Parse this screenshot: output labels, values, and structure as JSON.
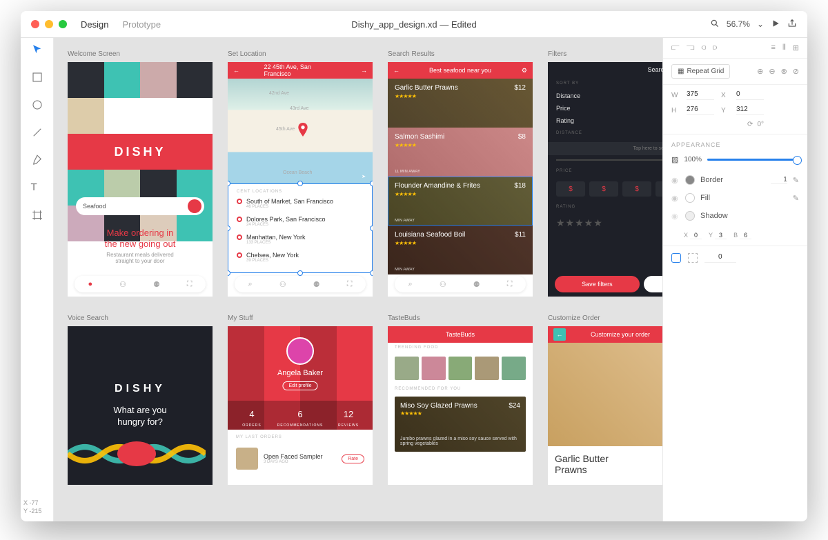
{
  "window": {
    "title": "Dishy_app_design.xd — Edited",
    "tabDesign": "Design",
    "tabPrototype": "Prototype",
    "zoom": "56.7%"
  },
  "coords": {
    "x": "X   -77",
    "y": "Y   -215"
  },
  "artboards": {
    "welcome": {
      "title": "Welcome Screen",
      "logo": "DISHY",
      "searchPlaceholder": "Seafood",
      "heroLine1": "Make ordering in",
      "heroLine2": "the new going out",
      "heroSub": "Restaurant meals delivered\nstraight to your door"
    },
    "location": {
      "title": "Set Location",
      "address": "22 45th Ave, San Francisco",
      "mapLabels": [
        "42nd Ave",
        "43rd Ave",
        "45th Ave",
        "Ocean Beach"
      ],
      "listHeader": "CENT LOCATIONS",
      "items": [
        {
          "name": "South of Market, San Francisco",
          "sub": "46 PLACES"
        },
        {
          "name": "Dolores Park, San Francisco",
          "sub": "24 PLACES"
        },
        {
          "name": "Manhattan, New York",
          "sub": "133 PLACES"
        },
        {
          "name": "Chelsea, New York",
          "sub": "39 PLACES"
        }
      ]
    },
    "results": {
      "title": "Search Results",
      "header": "Best seafood near you",
      "dishes": [
        {
          "name": "Garlic Butter Prawns",
          "price": "$12"
        },
        {
          "name": "Salmon Sashimi",
          "price": "$8",
          "dist": "11 MIN AWAY"
        },
        {
          "name": "Flounder Amandine & Frites",
          "price": "$18",
          "dist": "MIN AWAY"
        },
        {
          "name": "Louisiana Seafood Boil",
          "price": "$11",
          "dist": "MIN AWAY"
        }
      ]
    },
    "filters": {
      "title": "Filters",
      "header": "Search Filters",
      "sortBy": "SORT BY",
      "sorts": [
        "Distance",
        "Price",
        "Rating"
      ],
      "distance": "DISTANCE",
      "distHint": "Tap here to set distance",
      "price": "PRICE",
      "priceSymbols": [
        "$",
        "$",
        "$",
        "$"
      ],
      "rating": "RATING",
      "save": "Save filters"
    },
    "voice": {
      "title": "Voice Search",
      "logo": "DISHY",
      "q1": "What are you",
      "q2": "hungry for?"
    },
    "mystuff": {
      "title": "My Stuff",
      "user": "Angela Baker",
      "edit": "Edit profile",
      "stats": [
        {
          "n": "4",
          "l": "ORDERS"
        },
        {
          "n": "6",
          "l": "RECOMMENDATIONS"
        },
        {
          "n": "12",
          "l": "REVIEWS"
        }
      ],
      "lastOrders": "MY LAST ORDERS",
      "order": {
        "name": "Open Faced Sampler",
        "ago": "3 DAYS AGO",
        "rate": "Rate"
      }
    },
    "tastebuds": {
      "title": "TasteBuds",
      "header": "TasteBuds",
      "trending": "TRENDING FOOD",
      "recommended": "RECOMMENDED FOR YOU",
      "reco": {
        "name": "Miso Soy Glazed Prawns",
        "price": "$24",
        "desc": "Jumbo prawns glazed in a miso soy sauce served with spring vegetables"
      }
    },
    "customize": {
      "title": "Customize Order",
      "header": "Customize your order",
      "dish": "Garlic Butter\nPrawns"
    }
  },
  "panel": {
    "repeatGrid": "Repeat Grid",
    "w": "375",
    "x": "0",
    "h": "276",
    "y": "312",
    "rotation": "0°",
    "appearance": "APPEARANCE",
    "opacity": "100%",
    "border": "Border",
    "borderSize": "1",
    "fill": "Fill",
    "shadow": "Shadow",
    "sx": "0",
    "sy": "3",
    "sb": "6",
    "corner": "0"
  }
}
